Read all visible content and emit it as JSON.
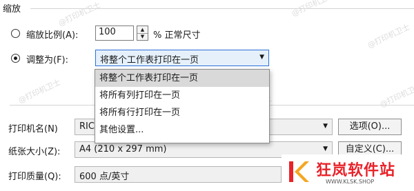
{
  "scaling": {
    "group_title": "缩放",
    "adjust_option": {
      "label": "缩放比例(A):",
      "value": "100",
      "suffix": "% 正常尺寸"
    },
    "fit_option": {
      "label": "调整为(F):",
      "value": "将整个工作表打印在一页"
    }
  },
  "fit_dropdown": {
    "options": [
      "将整个工作表打印在一页",
      "将所有列打印在一页",
      "将所有行打印在一页",
      "其他设置..."
    ],
    "selected_index": 0
  },
  "printer": {
    "label": "打印机名(N)",
    "value": "RIC",
    "button": "选项(O)..."
  },
  "paper": {
    "label": "纸张大小(Z):",
    "value": "A4 (210 x 297 mm)",
    "button": "自定义(C)..."
  },
  "quality": {
    "label": "打印质量(Q):",
    "value": "600 点/英寸"
  },
  "watermark": {
    "text": "@打印机卫士"
  },
  "logo": {
    "name": "狂岚软件站",
    "url": "WWW.KLSK.SHOP",
    "color": "#e8232a"
  }
}
